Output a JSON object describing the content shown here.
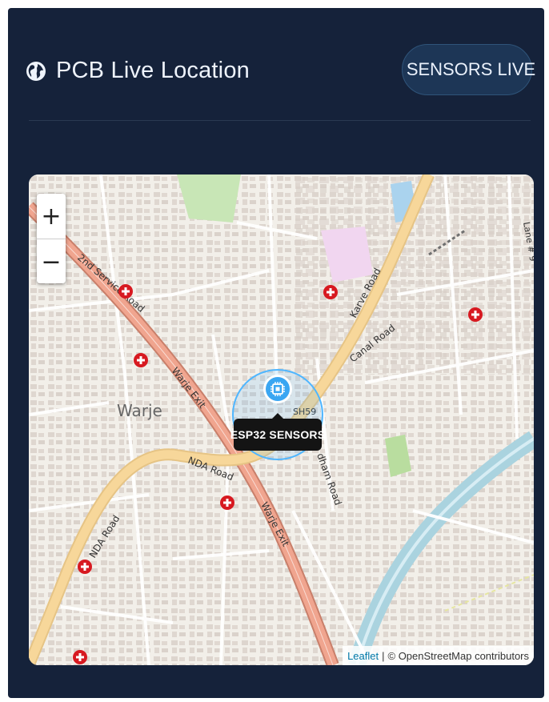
{
  "header": {
    "title": "PCB Live Location",
    "status_label": "SENSORS LIVE"
  },
  "map": {
    "zoom_in_label": "+",
    "zoom_out_label": "−",
    "marker_label": "ESP32 SENSORS",
    "attribution_leaflet": "Leaflet",
    "attribution_separator": "|",
    "attribution_osm": "© OpenStreetMap contributors",
    "labels": {
      "warje": "Warje",
      "karve_road": "Karve Road",
      "canal_road": "Canal Road",
      "second_service_road": "2nd Service Road",
      "warje_exit_1": "Warje Exit",
      "warje_exit_2": "Warje Exit",
      "nda_road_1": "NDA Road",
      "nda_road_2": "NDA Road",
      "highway": "SH59",
      "dham_road": "dham Road",
      "lane": "Lane # 9"
    }
  },
  "colors": {
    "card_bg": "#15223a",
    "accent": "#4fb6ff",
    "hospital": "#d71920"
  }
}
